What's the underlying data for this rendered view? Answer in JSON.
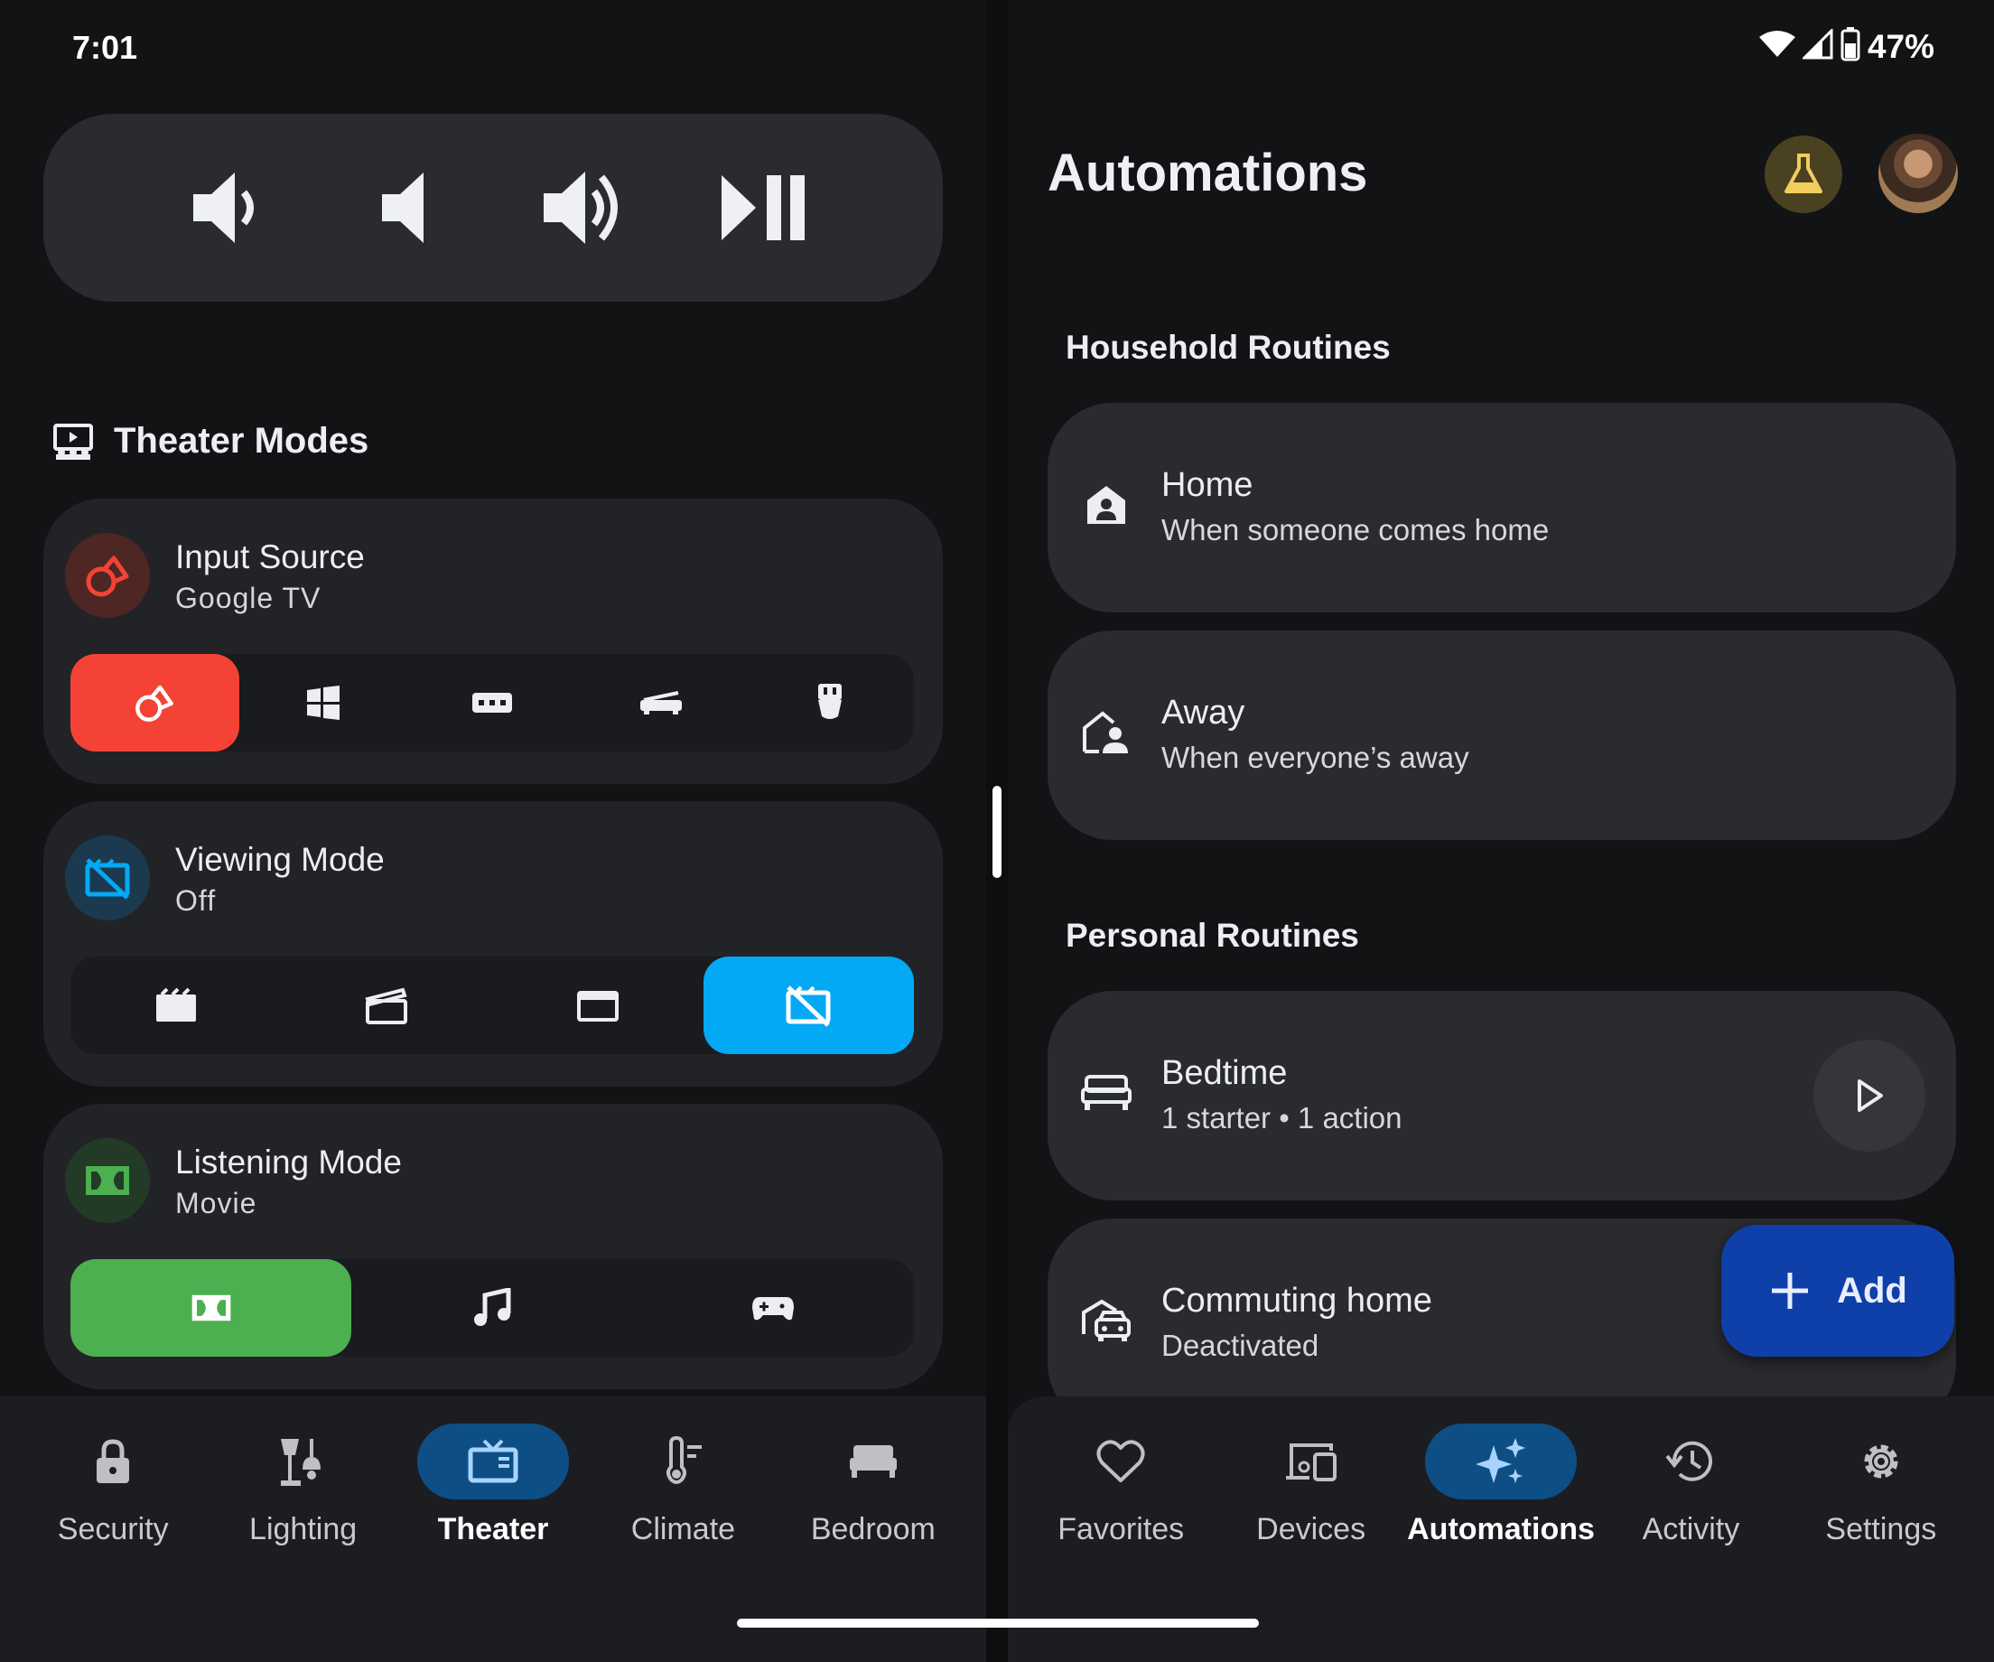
{
  "status": {
    "time": "7:01",
    "battery": "47%"
  },
  "left": {
    "section_title": "Theater Modes",
    "cards": [
      {
        "title": "Input Source",
        "subtitle": "Google TV",
        "accent": "#f44336"
      },
      {
        "title": "Viewing Mode",
        "subtitle": "Off",
        "accent": "#03a9f4"
      },
      {
        "title": "Listening Mode",
        "subtitle": "Movie",
        "accent": "#4caf50"
      }
    ],
    "nav": [
      {
        "label": "Security",
        "icon": "lock-icon"
      },
      {
        "label": "Lighting",
        "icon": "lamp-icon"
      },
      {
        "label": "Theater",
        "icon": "tv-icon",
        "active": true
      },
      {
        "label": "Climate",
        "icon": "thermostat-icon"
      },
      {
        "label": "Bedroom",
        "icon": "bed-icon"
      }
    ]
  },
  "right": {
    "title": "Automations",
    "household_label": "Household Routines",
    "personal_label": "Personal Routines",
    "household": [
      {
        "title": "Home",
        "subtitle": "When someone comes home",
        "icon": "home-person-icon"
      },
      {
        "title": "Away",
        "subtitle": "When everyone’s away",
        "icon": "away-icon"
      }
    ],
    "personal": [
      {
        "title": "Bedtime",
        "subtitle": "1 starter • 1 action",
        "icon": "bed-icon"
      },
      {
        "title": "Commuting home",
        "subtitle": "Deactivated",
        "icon": "commute-icon"
      }
    ],
    "fab_label": "Add",
    "nav": [
      {
        "label": "Favorites",
        "icon": "heart-icon"
      },
      {
        "label": "Devices",
        "icon": "devices-icon"
      },
      {
        "label": "Automations",
        "icon": "sparkle-icon",
        "active": true
      },
      {
        "label": "Activity",
        "icon": "history-icon"
      },
      {
        "label": "Settings",
        "icon": "gear-icon"
      }
    ]
  }
}
